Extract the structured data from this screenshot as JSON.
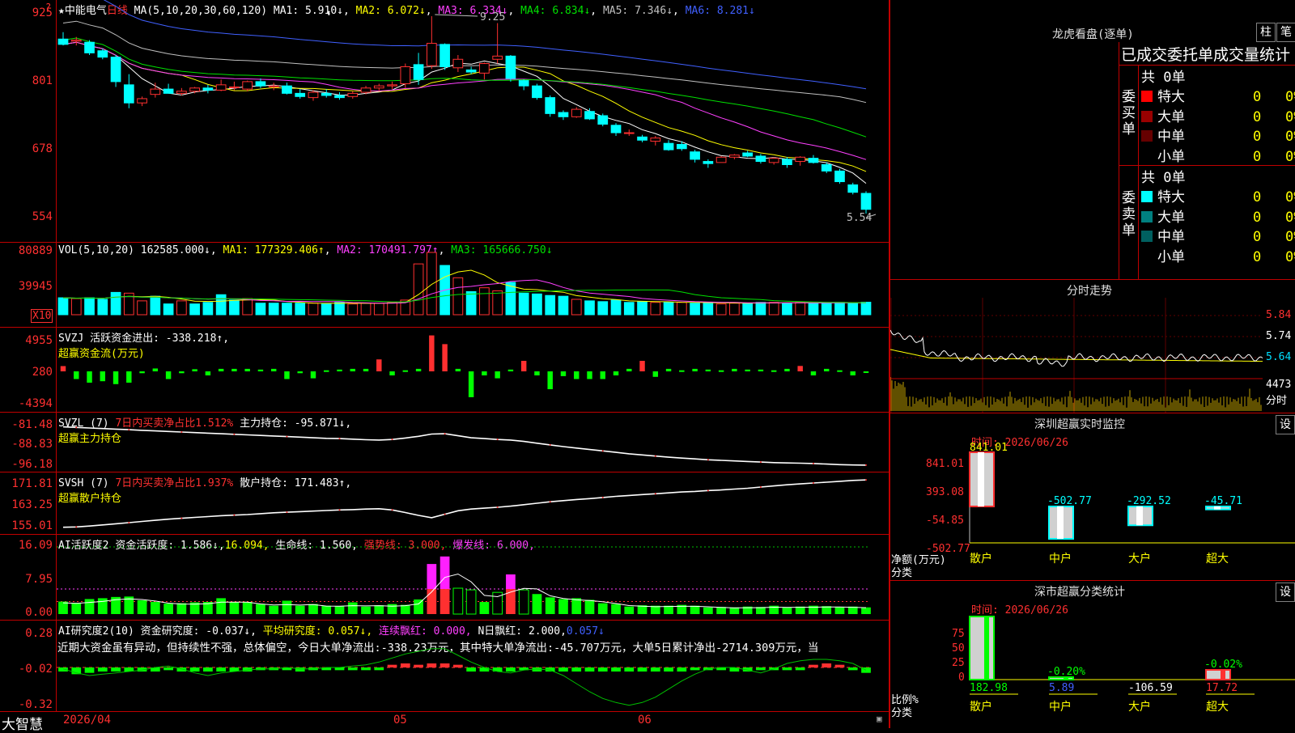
{
  "stock": {
    "name": "★中能电气",
    "period": "日线",
    "ma_label": "MA(5,10,20,30,60,120)",
    "ma": [
      {
        "name": "MA1",
        "value": "5.910↓",
        "color": "#ffffff"
      },
      {
        "name": "MA2",
        "value": "6.072↓",
        "color": "#ffff00"
      },
      {
        "name": "MA3",
        "value": "6.334↓",
        "color": "#ff40ff"
      },
      {
        "name": "MA4",
        "value": "6.834↓",
        "color": "#00e000"
      },
      {
        "name": "MA5",
        "value": "7.346↓",
        "color": "#c0c0c0"
      },
      {
        "name": "MA6",
        "value": "8.281↓",
        "color": "#4060ff"
      }
    ],
    "high_mark": "9.25",
    "low_mark": "5.54",
    "price_axis": [
      "925",
      "801",
      "678",
      "554"
    ],
    "corner_icon": "question-icon"
  },
  "volume": {
    "label": "VOL(5,10,20)",
    "value": "162585.000↓",
    "ma": [
      {
        "name": "MA1",
        "value": "177329.406↑",
        "color": "#ffff00"
      },
      {
        "name": "MA2",
        "value": "170491.797↑",
        "color": "#ff40ff"
      },
      {
        "name": "MA3",
        "value": "165666.750↓",
        "color": "#00e000"
      }
    ],
    "axis": [
      "80889",
      "39945"
    ],
    "unit": "X10"
  },
  "svzj": {
    "label": "SVZJ  活跃资金进出:",
    "value": "-338.218↑,",
    "subtitle": "超赢资金流(万元)",
    "axis": [
      "4955",
      "280",
      "-4394"
    ]
  },
  "svzl": {
    "label": "SVZL (7)",
    "ratio": "7日内买卖净占比1.512%",
    "hold": "主力持仓:",
    "hold_value": "-95.871↓,",
    "subtitle": "超赢主力持仓",
    "axis": [
      "-81.48",
      "-88.83",
      "-96.18"
    ]
  },
  "svsh": {
    "label": "SVSH (7)",
    "ratio": "7日内买卖净占比1.937%",
    "hold": "散户持仓:",
    "hold_value": "171.483↑,",
    "subtitle": "超赢散户持仓",
    "axis": [
      "171.81",
      "163.25",
      "155.01"
    ]
  },
  "ai_active": {
    "label": "AI活跃度2",
    "items": [
      {
        "text": "资金活跃度: 1.586↓,",
        "color": "#ffffff"
      },
      {
        "text": "16.094,",
        "color": "#ffff00"
      },
      {
        "text": "生命线: 1.560,",
        "color": "#ffffff"
      },
      {
        "text": "强势线: 3.000,",
        "color": "#ff3030"
      },
      {
        "text": "爆发线: 6.000,",
        "color": "#ff40ff"
      }
    ],
    "axis": [
      "16.09",
      "7.95",
      "0.00"
    ]
  },
  "ai_research": {
    "label": "AI研究度2(10)",
    "items": [
      {
        "text": "资金研究度: -0.037↓,",
        "color": "#ffffff"
      },
      {
        "text": "平均研究度: 0.057↓,",
        "color": "#ffff00"
      },
      {
        "text": "连续飘红: 0.000,",
        "color": "#ff40ff"
      },
      {
        "text": "N日飘红: 2.000,",
        "color": "#ffffff"
      },
      {
        "text": "0.057↓",
        "color": "#4060ff"
      }
    ],
    "comment": "近期大资金虽有异动，但持续性不强，总体偏空，今日大单净流出:-338.23万元，其中特大单净流出:-45.707万元，大单5日累计净出-2714.309万元，当",
    "axis": [
      "0.28",
      "-0.02",
      "-0.32"
    ]
  },
  "time_axis": {
    "brand": "大智慧",
    "labels": [
      "2026/04",
      "05",
      "06"
    ]
  },
  "dragon_tiger": {
    "title": "龙虎看盘(逐单)",
    "btn_bar": "柱",
    "btn_stroke": "笔",
    "tabs": "已成交委托单成交量统计",
    "buy_side": "委买单",
    "sell_side": "委卖单",
    "buy_total": "共 0单",
    "sell_total": "共 0单",
    "buy_rows": [
      {
        "label": "特大",
        "color": "#ff0000",
        "count": "0",
        "pct": "0%"
      },
      {
        "label": "大单",
        "color": "#990000",
        "count": "0",
        "pct": "0%"
      },
      {
        "label": "中单",
        "color": "#660000",
        "count": "0",
        "pct": "0%"
      },
      {
        "label": "小单",
        "color": "#000000",
        "count": "0",
        "pct": "0%"
      }
    ],
    "sell_rows": [
      {
        "label": "特大",
        "color": "#00ffff",
        "count": "0",
        "pct": "0%"
      },
      {
        "label": "大单",
        "color": "#008080",
        "count": "0",
        "pct": "0%"
      },
      {
        "label": "中单",
        "color": "#006060",
        "count": "0",
        "pct": "0%"
      },
      {
        "label": "小单",
        "color": "#000000",
        "count": "0",
        "pct": "0%"
      }
    ]
  },
  "intraday": {
    "title": "分时走势",
    "price_axis": [
      "5.84",
      "5.74",
      "5.64"
    ],
    "volume_label": "4473",
    "tab": "分时"
  },
  "sz_monitor": {
    "title": "深圳超赢实时监控",
    "date": "时间: 2026/06/26",
    "settings": "设",
    "axis": [
      "841.01",
      "393.08",
      "-54.85",
      "-502.77"
    ],
    "ylabel": "净额(万元)",
    "xlabel": "分类",
    "bars": [
      {
        "cat": "散户",
        "value": "841.01",
        "num": 841.01
      },
      {
        "cat": "中户",
        "value": "-502.77",
        "num": -502.77
      },
      {
        "cat": "大户",
        "value": "-292.52",
        "num": -292.52
      },
      {
        "cat": "超大",
        "value": "-45.71",
        "num": -45.71
      }
    ]
  },
  "sz_stats": {
    "title": "深市超赢分类统计",
    "date": "时间: 2026/06/26",
    "settings": "设",
    "axis": [
      "75",
      "50",
      "25",
      "0"
    ],
    "ylabel": "比例%",
    "xlabel": "分类",
    "bars": [
      {
        "cat": "散户",
        "value": "182.98",
        "num": 182.98,
        "top": ""
      },
      {
        "cat": "中户",
        "value": "5.89",
        "num": 5.89,
        "top": "-0.20%"
      },
      {
        "cat": "大户",
        "value": "-106.59",
        "num": -106.59,
        "top": ""
      },
      {
        "cat": "超大",
        "value": "17.72",
        "num": 17.72,
        "top": "-0.02%"
      }
    ]
  },
  "chart_data": [
    {
      "type": "candlestick",
      "title": "中能电气 日线",
      "ylim": [
        5.54,
        9.25
      ],
      "ohlc": [
        [
          8.82,
          8.95,
          8.7,
          8.72
        ],
        [
          8.78,
          8.86,
          8.7,
          8.8
        ],
        [
          8.76,
          8.8,
          8.52,
          8.56
        ],
        [
          8.6,
          8.64,
          8.44,
          8.48
        ],
        [
          8.48,
          8.52,
          7.92,
          8.02
        ],
        [
          7.96,
          8.16,
          7.52,
          7.62
        ],
        [
          7.62,
          7.74,
          7.56,
          7.7
        ],
        [
          7.78,
          8.0,
          7.72,
          7.88
        ],
        [
          7.88,
          7.98,
          7.8,
          7.8
        ],
        [
          7.8,
          7.9,
          7.76,
          7.84
        ],
        [
          7.84,
          7.92,
          7.8,
          7.9
        ],
        [
          7.9,
          7.96,
          7.8,
          7.86
        ],
        [
          7.86,
          8.06,
          7.84,
          7.96
        ],
        [
          7.92,
          8.02,
          7.86,
          7.92
        ],
        [
          7.88,
          8.04,
          7.84,
          8.02
        ],
        [
          8.02,
          8.08,
          7.9,
          7.94
        ],
        [
          7.92,
          8.0,
          7.86,
          7.94
        ],
        [
          7.94,
          8.0,
          7.78,
          7.8
        ],
        [
          7.8,
          7.88,
          7.7,
          7.74
        ],
        [
          7.72,
          7.86,
          7.66,
          7.82
        ],
        [
          7.8,
          7.88,
          7.72,
          7.76
        ],
        [
          7.76,
          7.82,
          7.68,
          7.72
        ],
        [
          7.74,
          7.84,
          7.7,
          7.8
        ],
        [
          7.82,
          7.94,
          7.78,
          7.9
        ],
        [
          7.9,
          7.98,
          7.84,
          7.94
        ],
        [
          7.94,
          8.02,
          7.88,
          7.96
        ],
        [
          7.98,
          8.36,
          7.9,
          8.3
        ],
        [
          8.34,
          8.56,
          7.96,
          8.06
        ],
        [
          8.32,
          9.25,
          8.26,
          8.74
        ],
        [
          8.72,
          8.74,
          8.24,
          8.3
        ],
        [
          8.28,
          8.52,
          8.2,
          8.44
        ],
        [
          8.24,
          8.3,
          8.16,
          8.2
        ],
        [
          8.18,
          8.38,
          8.06,
          8.36
        ],
        [
          8.44,
          9.12,
          8.36,
          8.5
        ],
        [
          8.5,
          8.52,
          8.02,
          8.08
        ],
        [
          8.04,
          8.06,
          7.86,
          7.94
        ],
        [
          7.94,
          7.98,
          7.68,
          7.72
        ],
        [
          7.72,
          7.76,
          7.36,
          7.42
        ],
        [
          7.44,
          7.48,
          7.3,
          7.36
        ],
        [
          7.36,
          7.54,
          7.34,
          7.5
        ],
        [
          7.46,
          7.52,
          7.3,
          7.32
        ],
        [
          7.38,
          7.42,
          7.18,
          7.22
        ],
        [
          7.2,
          7.24,
          7.0,
          7.06
        ],
        [
          7.06,
          7.12,
          7.0,
          7.06
        ],
        [
          6.98,
          7.02,
          6.88,
          6.92
        ],
        [
          6.9,
          7.0,
          6.82,
          6.96
        ],
        [
          6.86,
          6.92,
          6.72,
          6.74
        ],
        [
          6.84,
          6.9,
          6.72,
          6.76
        ],
        [
          6.7,
          6.74,
          6.5,
          6.56
        ],
        [
          6.52,
          6.56,
          6.4,
          6.48
        ],
        [
          6.5,
          6.62,
          6.5,
          6.6
        ],
        [
          6.6,
          6.66,
          6.56,
          6.64
        ],
        [
          6.68,
          6.72,
          6.6,
          6.62
        ],
        [
          6.62,
          6.66,
          6.48,
          6.52
        ],
        [
          6.5,
          6.6,
          6.46,
          6.58
        ],
        [
          6.56,
          6.6,
          6.4,
          6.46
        ],
        [
          6.52,
          6.62,
          6.44,
          6.6
        ],
        [
          6.58,
          6.64,
          6.48,
          6.5
        ],
        [
          6.46,
          6.5,
          6.3,
          6.34
        ],
        [
          6.34,
          6.38,
          6.1,
          6.14
        ],
        [
          6.08,
          6.12,
          5.9,
          5.94
        ],
        [
          5.92,
          5.96,
          5.54,
          5.62
        ]
      ]
    },
    {
      "type": "bar",
      "title": "VOL(5,10,20)",
      "ylim": [
        0,
        80889
      ],
      "values": [
        22000,
        21000,
        22000,
        20000,
        29000,
        28000,
        18000,
        24000,
        14000,
        18000,
        14000,
        16000,
        26000,
        19000,
        21000,
        15000,
        15000,
        15000,
        15000,
        15000,
        14000,
        16000,
        14000,
        15000,
        15000,
        16000,
        19000,
        66000,
        80889,
        64000,
        48000,
        30000,
        35000,
        31000,
        42000,
        28000,
        27000,
        25000,
        24000,
        20000,
        18000,
        17000,
        19000,
        16000,
        17000,
        16000,
        16000,
        16000,
        15000,
        16000,
        14000,
        15000,
        15000,
        16000,
        16000,
        15000,
        16000,
        15000,
        15000,
        16000,
        15000,
        16258
      ],
      "up": [
        0,
        1,
        0,
        0,
        0,
        1,
        1,
        0,
        0,
        1,
        0,
        0,
        0,
        0,
        1,
        0,
        0,
        0,
        0,
        1,
        0,
        0,
        1,
        1,
        1,
        1,
        1,
        1,
        1,
        0,
        1,
        0,
        1,
        1,
        0,
        0,
        0,
        0,
        0,
        1,
        0,
        0,
        0,
        0,
        0,
        1,
        0,
        1,
        0,
        0,
        1,
        1,
        0,
        0,
        1,
        0,
        1,
        0,
        0,
        0,
        0,
        0
      ]
    },
    {
      "type": "bar",
      "title": "超赢资金流(万元)",
      "ylim": [
        -4394,
        4955
      ],
      "values": [
        280,
        -1500,
        -2000,
        -1800,
        -2200,
        -2000,
        -700,
        -50,
        -1500,
        -700,
        -150,
        -1000,
        -100,
        -100,
        -100,
        -200,
        -100,
        -1500,
        -700,
        -1400,
        -300,
        -200,
        -100,
        -100,
        1200,
        -1000,
        -300,
        -100,
        4500,
        3300,
        -100,
        -4000,
        -1000,
        -1400,
        -200,
        1000,
        -1000,
        -2900,
        -1100,
        -1500,
        -1500,
        -1500,
        -1000,
        -100,
        1000,
        -1200,
        -100,
        -300,
        -100,
        -200,
        -300,
        -100,
        -200,
        -200,
        -300,
        -100,
        300,
        -1000,
        -100,
        -300,
        -1000,
        -600
      ],
      "line": [
        250,
        -3000,
        -3300,
        -3400,
        -3400,
        -3600,
        -3500,
        -3400,
        -3100,
        -2800,
        -2600,
        -2300,
        -2300,
        -2000,
        -1800,
        -1900,
        -2000,
        -2000,
        -2000,
        -2200,
        -2500,
        -2600,
        -2600,
        -2600,
        -2300,
        -2600,
        -2700,
        -2800,
        -2400,
        -2000,
        -2000,
        -2400,
        -2600,
        -2700,
        -2800,
        -2800,
        -2900,
        -3000,
        -3000,
        -2900,
        -3000,
        -3000,
        -2900,
        -2900,
        -2800,
        -2800,
        -2700,
        -2700,
        -2700,
        -2700,
        -2700,
        -2700,
        -2700,
        -2700,
        -2700,
        -2600,
        -2600,
        -2600,
        -2600,
        -2500,
        -2500,
        -2500
      ]
    },
    {
      "type": "line",
      "title": "超赢主力持仓",
      "ylim": [
        -96.18,
        -81.48
      ],
      "values": [
        -82.5,
        -82.7,
        -82.9,
        -83.1,
        -83.3,
        -83.5,
        -83.7,
        -83.9,
        -84.1,
        -84.3,
        -84.5,
        -84.7,
        -84.9,
        -85.1,
        -85.3,
        -85.5,
        -85.7,
        -85.9,
        -86.1,
        -86.3,
        -86.5,
        -86.6,
        -86.8,
        -87.0,
        -87.1,
        -86.9,
        -86.4,
        -85.8,
        -85.0,
        -84.9,
        -85.6,
        -86.3,
        -86.6,
        -86.9,
        -87.1,
        -87.6,
        -88.2,
        -88.8,
        -89.4,
        -89.9,
        -90.4,
        -90.9,
        -91.4,
        -91.9,
        -92.3,
        -92.7,
        -93.1,
        -93.4,
        -93.7,
        -94.0,
        -94.2,
        -94.4,
        -94.6,
        -94.8,
        -95.0,
        -95.1,
        -95.2,
        -95.3,
        -95.5,
        -95.7,
        -95.8,
        -95.87
      ]
    },
    {
      "type": "line",
      "title": "超赢散户持仓",
      "ylim": [
        155.01,
        171.81
      ],
      "values": [
        155.1,
        155.2,
        155.5,
        155.9,
        156.3,
        156.7,
        157.1,
        157.5,
        157.9,
        158.2,
        158.5,
        158.8,
        159.1,
        159.3,
        159.5,
        159.8,
        160.1,
        160.3,
        160.5,
        160.7,
        160.9,
        161.1,
        161.2,
        161.4,
        161.5,
        161.1,
        160.2,
        159.2,
        158.4,
        159.6,
        160.8,
        161.4,
        161.7,
        162.0,
        162.4,
        162.9,
        163.4,
        163.9,
        164.3,
        164.7,
        165.0,
        165.4,
        165.8,
        166.1,
        166.4,
        166.7,
        167.0,
        167.3,
        167.5,
        167.8,
        168.0,
        168.3,
        168.6,
        169.0,
        169.4,
        169.8,
        170.1,
        170.4,
        170.7,
        171.0,
        171.3,
        171.48
      ]
    },
    {
      "type": "bar",
      "title": "AI活跃度2",
      "ylim": [
        0,
        16.09
      ],
      "values": [
        3.0,
        2.7,
        3.6,
        3.8,
        4.1,
        4.2,
        3.3,
        2.9,
        2.5,
        2.6,
        2.8,
        2.9,
        3.8,
        2.8,
        2.9,
        2.4,
        2.0,
        3.2,
        2.0,
        2.4,
        2.0,
        1.9,
        2.8,
        1.8,
        2.1,
        2.4,
        2.2,
        3.5,
        12.0,
        13.8,
        6.2,
        5.8,
        2.9,
        5.2,
        9.5,
        5.8,
        4.8,
        4.0,
        3.6,
        3.8,
        3.4,
        2.6,
        2.4,
        1.8,
        2.1,
        2.0,
        2.0,
        2.2,
        2.0,
        1.6,
        1.7,
        1.6,
        1.8,
        1.7,
        2.0,
        1.6,
        1.8,
        2.0,
        1.9,
        1.7,
        1.8,
        1.6
      ],
      "strong_line": 3.0,
      "burst_line": 6.0,
      "top_line": 16.09
    },
    {
      "type": "bar",
      "title": "AI研究度2",
      "ylim": [
        -0.32,
        0.28
      ],
      "values": [
        -0.03,
        -0.05,
        -0.04,
        -0.03,
        -0.03,
        -0.03,
        -0.03,
        -0.03,
        -0.02,
        -0.03,
        -0.03,
        -0.03,
        -0.03,
        -0.03,
        -0.03,
        -0.02,
        -0.02,
        -0.02,
        -0.03,
        -0.02,
        -0.02,
        -0.02,
        -0.02,
        -0.02,
        -0.02,
        0.02,
        0.03,
        0.02,
        0.03,
        0.03,
        0.02,
        -0.03,
        -0.03,
        -0.03,
        -0.03,
        -0.02,
        -0.03,
        -0.03,
        -0.03,
        -0.03,
        -0.03,
        -0.03,
        -0.03,
        -0.03,
        -0.03,
        -0.03,
        -0.03,
        -0.03,
        -0.02,
        -0.02,
        -0.02,
        -0.03,
        -0.03,
        -0.02,
        -0.02,
        -0.02,
        -0.02,
        0.02,
        0.03,
        0.02,
        -0.02,
        -0.04
      ],
      "line": [
        -0.03,
        -0.06,
        -0.08,
        -0.07,
        -0.06,
        -0.05,
        -0.04,
        -0.02,
        -0.01,
        -0.03,
        -0.06,
        -0.08,
        -0.06,
        -0.05,
        -0.04,
        -0.03,
        -0.03,
        -0.02,
        -0.03,
        -0.03,
        -0.02,
        -0.02,
        -0.01,
        0.0,
        0.02,
        0.05,
        0.08,
        0.1,
        0.12,
        0.12,
        0.07,
        0.02,
        -0.02,
        -0.05,
        -0.06,
        -0.04,
        -0.03,
        -0.04,
        -0.08,
        -0.14,
        -0.2,
        -0.25,
        -0.28,
        -0.3,
        -0.28,
        -0.24,
        -0.18,
        -0.12,
        -0.07,
        -0.03,
        -0.02,
        -0.02,
        -0.04,
        -0.06,
        -0.03,
        0.01,
        0.03,
        0.04,
        0.04,
        0.03,
        0.01,
        -0.04
      ]
    }
  ]
}
